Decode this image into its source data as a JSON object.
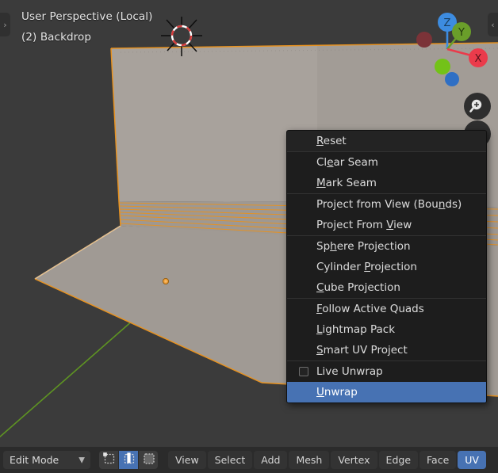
{
  "viewport": {
    "header_line1": "User Perspective (Local)",
    "header_line2": "(2) Backdrop",
    "background_color": "#3b3b3b",
    "mesh_color": "#a09a94",
    "selected_edge_color": "#e8921f",
    "origin_color": "#f0a13a",
    "y_axis_color": "#6fa32b",
    "left_tab_icon": "chevron-right-icon",
    "left_tab_glyph": "›",
    "right_tab_icon": "chevron-left-icon",
    "right_tab_glyph": "‹"
  },
  "gizmo": {
    "axes": [
      {
        "label": "Z",
        "color": "#3d8ce0",
        "text_color": "#16324f",
        "positive": true
      },
      {
        "label": "Y",
        "color": "#6a9e2a",
        "text_color": "#22330d",
        "positive": true
      },
      {
        "label": "X",
        "color": "#ea3b4b",
        "text_color": "#4f1018",
        "positive": true
      },
      {
        "label": "",
        "color": "#7b3338",
        "text_color": "",
        "positive": false
      },
      {
        "label": "",
        "color": "#73c218",
        "text_color": "",
        "positive": false
      },
      {
        "label": "",
        "color": "#2f6fc4",
        "text_color": "",
        "positive": false
      }
    ]
  },
  "zoom_button": {
    "icon": "zoom-in-icon"
  },
  "uv_menu": {
    "accent_color": "#4772b3",
    "sections": [
      {
        "items": [
          {
            "label": "Reset",
            "accel_index": 0,
            "type": "item"
          }
        ]
      },
      {
        "items": [
          {
            "label": "Clear Seam",
            "accel_index": 2,
            "type": "item"
          },
          {
            "label": "Mark Seam",
            "accel_index": 0,
            "type": "item"
          }
        ]
      },
      {
        "items": [
          {
            "label": "Project from View (Bounds)",
            "accel_index": 22,
            "type": "item"
          },
          {
            "label": "Project From View",
            "accel_index": 13,
            "type": "item"
          }
        ]
      },
      {
        "items": [
          {
            "label": "Sphere Projection",
            "accel_index": 2,
            "type": "item"
          },
          {
            "label": "Cylinder Projection",
            "accel_index": 9,
            "type": "item"
          },
          {
            "label": "Cube Projection",
            "accel_index": 0,
            "type": "item"
          }
        ]
      },
      {
        "items": [
          {
            "label": "Follow Active Quads",
            "accel_index": 0,
            "type": "item"
          },
          {
            "label": "Lightmap Pack",
            "accel_index": 0,
            "type": "item"
          },
          {
            "label": "Smart UV Project",
            "accel_index": 0,
            "type": "item"
          }
        ]
      },
      {
        "items": [
          {
            "label": "Live Unwrap",
            "accel_index": -1,
            "type": "checkbox",
            "checked": false
          },
          {
            "label": "Unwrap",
            "accel_index": 0,
            "type": "item",
            "selected": true
          }
        ]
      }
    ]
  },
  "bottom_bar": {
    "mode": "Edit Mode",
    "mode_caret_icon": "chevron-down-icon",
    "select_modes": [
      {
        "name": "vertex-select-mode",
        "icon": "vertex-select-icon",
        "active": false
      },
      {
        "name": "edge-select-mode",
        "icon": "edge-select-icon",
        "active": true
      },
      {
        "name": "face-select-mode",
        "icon": "face-select-icon",
        "active": false
      }
    ],
    "menus": [
      {
        "label": "View",
        "active": false
      },
      {
        "label": "Select",
        "active": false
      },
      {
        "label": "Add",
        "active": false
      },
      {
        "label": "Mesh",
        "active": false
      },
      {
        "label": "Vertex",
        "active": false
      },
      {
        "label": "Edge",
        "active": false
      },
      {
        "label": "Face",
        "active": false
      },
      {
        "label": "UV",
        "active": true
      }
    ]
  }
}
